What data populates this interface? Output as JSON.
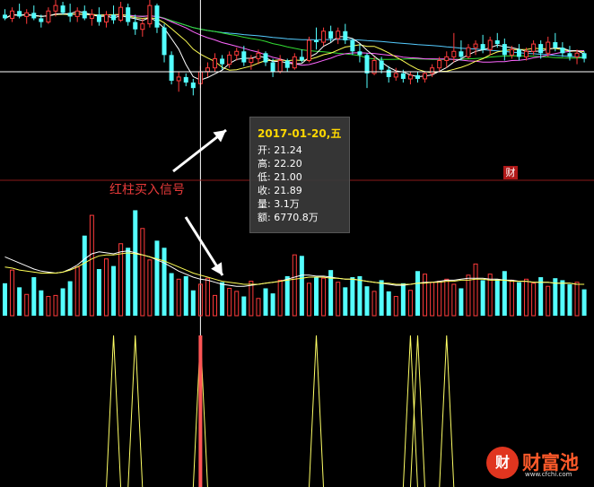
{
  "tooltip": {
    "date": "2017-01-20,五",
    "rows": [
      {
        "label": "开:",
        "value": "21.24"
      },
      {
        "label": "高:",
        "value": "22.20"
      },
      {
        "label": "低:",
        "value": "21.00"
      },
      {
        "label": "收:",
        "value": "21.89"
      },
      {
        "label": "量:",
        "value": "3.1万"
      },
      {
        "label": "额:",
        "value": "6770.8万"
      }
    ]
  },
  "annotation": "红柱买入信号",
  "badge": "财",
  "logo": {
    "icon": "财",
    "text": "财富池",
    "url": "www.cfchi.com"
  },
  "colors": {
    "up": "#ff3b3b",
    "down": "#54ffff",
    "ma5": "#ffffff",
    "ma10": "#ffff55",
    "ma20": "#ff66ff",
    "ma30": "#33dd33",
    "ma60": "#55ccff",
    "signal": "#ffff66",
    "signal_bar": "#ff5555",
    "crosshair": "#ffffff",
    "divider": "#8a1a1a"
  },
  "chart_data": [
    {
      "type": "candlestick",
      "name": "price",
      "ylim": [
        19.2,
        25.8
      ],
      "crosshair_index": 27,
      "crosshair_price": 21.89,
      "candles": [
        [
          25.0,
          25.3,
          24.7,
          24.8
        ],
        [
          24.8,
          25.4,
          24.6,
          25.2
        ],
        [
          25.2,
          25.6,
          24.8,
          24.9
        ],
        [
          24.9,
          25.3,
          24.5,
          25.1
        ],
        [
          25.1,
          25.5,
          24.7,
          24.8
        ],
        [
          24.8,
          25.0,
          24.3,
          24.6
        ],
        [
          24.6,
          25.4,
          24.5,
          25.2
        ],
        [
          25.2,
          25.8,
          24.9,
          25.5
        ],
        [
          25.5,
          25.7,
          25.0,
          25.1
        ],
        [
          25.1,
          25.6,
          24.6,
          24.9
        ],
        [
          24.9,
          25.4,
          24.6,
          25.2
        ],
        [
          25.2,
          25.5,
          24.7,
          24.8
        ],
        [
          24.8,
          25.3,
          24.4,
          25.0
        ],
        [
          25.0,
          25.4,
          24.4,
          24.6
        ],
        [
          24.6,
          25.2,
          24.3,
          25.0
        ],
        [
          25.0,
          25.5,
          24.5,
          24.7
        ],
        [
          24.7,
          25.7,
          24.6,
          25.4
        ],
        [
          25.4,
          25.6,
          24.4,
          24.6
        ],
        [
          24.6,
          25.0,
          23.9,
          24.2
        ],
        [
          24.2,
          24.8,
          23.8,
          24.5
        ],
        [
          24.5,
          25.8,
          24.3,
          25.5
        ],
        [
          25.5,
          25.6,
          24.0,
          24.3
        ],
        [
          24.3,
          24.5,
          22.4,
          22.8
        ],
        [
          22.8,
          23.0,
          21.2,
          21.4
        ],
        [
          21.4,
          21.9,
          20.8,
          21.6
        ],
        [
          21.6,
          21.8,
          21.1,
          21.3
        ],
        [
          21.3,
          21.5,
          20.6,
          21.0
        ],
        [
          21.24,
          22.2,
          21.0,
          21.89
        ],
        [
          21.9,
          22.4,
          21.6,
          22.1
        ],
        [
          22.1,
          22.9,
          21.9,
          22.6
        ],
        [
          22.6,
          22.8,
          22.0,
          22.3
        ],
        [
          22.3,
          23.0,
          22.1,
          22.8
        ],
        [
          22.8,
          23.2,
          22.5,
          23.0
        ],
        [
          23.0,
          23.3,
          22.2,
          22.4
        ],
        [
          22.4,
          22.8,
          22.0,
          22.6
        ],
        [
          22.6,
          23.1,
          22.3,
          22.9
        ],
        [
          22.9,
          23.0,
          22.2,
          22.4
        ],
        [
          22.4,
          22.6,
          21.6,
          21.9
        ],
        [
          21.9,
          22.8,
          21.8,
          22.5
        ],
        [
          22.5,
          22.6,
          21.9,
          22.1
        ],
        [
          22.1,
          22.9,
          22.0,
          22.7
        ],
        [
          22.7,
          23.1,
          22.4,
          22.5
        ],
        [
          22.5,
          23.8,
          22.4,
          23.6
        ],
        [
          23.6,
          24.3,
          23.1,
          23.5
        ],
        [
          23.5,
          24.3,
          23.3,
          24.1
        ],
        [
          24.1,
          24.4,
          23.5,
          23.7
        ],
        [
          23.7,
          24.3,
          23.4,
          24.1
        ],
        [
          24.1,
          24.5,
          23.4,
          23.6
        ],
        [
          23.6,
          23.7,
          22.8,
          23.0
        ],
        [
          23.0,
          23.4,
          22.4,
          22.8
        ],
        [
          22.8,
          22.9,
          21.0,
          21.8
        ],
        [
          21.8,
          22.7,
          21.7,
          22.5
        ],
        [
          22.5,
          22.7,
          21.8,
          22.0
        ],
        [
          22.0,
          22.2,
          21.3,
          21.6
        ],
        [
          21.6,
          22.1,
          21.4,
          21.8
        ],
        [
          21.8,
          22.0,
          21.3,
          21.5
        ],
        [
          21.5,
          21.9,
          21.2,
          21.7
        ],
        [
          21.7,
          21.9,
          21.3,
          21.5
        ],
        [
          21.5,
          21.9,
          21.3,
          21.8
        ],
        [
          21.8,
          22.3,
          21.6,
          22.1
        ],
        [
          22.1,
          22.7,
          21.9,
          22.5
        ],
        [
          22.5,
          23.0,
          22.1,
          22.7
        ],
        [
          22.7,
          24.0,
          22.4,
          23.0
        ],
        [
          23.0,
          23.6,
          22.5,
          22.7
        ],
        [
          22.7,
          23.4,
          22.6,
          23.2
        ],
        [
          23.2,
          23.6,
          22.8,
          23.4
        ],
        [
          23.4,
          23.9,
          22.9,
          23.1
        ],
        [
          23.1,
          23.8,
          22.8,
          23.6
        ],
        [
          23.6,
          24.0,
          23.2,
          23.4
        ],
        [
          23.4,
          23.7,
          22.5,
          22.8
        ],
        [
          22.8,
          23.3,
          22.6,
          23.1
        ],
        [
          23.1,
          23.4,
          22.5,
          22.7
        ],
        [
          22.7,
          23.2,
          22.5,
          23.0
        ],
        [
          23.0,
          23.6,
          22.8,
          23.4
        ],
        [
          23.4,
          23.6,
          22.6,
          22.9
        ],
        [
          22.9,
          23.8,
          22.7,
          23.5
        ],
        [
          23.5,
          24.0,
          23.0,
          23.2
        ],
        [
          23.2,
          23.5,
          22.7,
          22.9
        ],
        [
          22.9,
          23.3,
          22.5,
          22.7
        ],
        [
          22.7,
          23.1,
          22.3,
          22.9
        ],
        [
          22.9,
          23.0,
          22.4,
          22.6
        ]
      ]
    },
    {
      "type": "bar",
      "name": "volume",
      "ylim": [
        0,
        11.5
      ],
      "values": [
        3.2,
        4.5,
        2.8,
        2.1,
        3.8,
        2.5,
        1.9,
        2.0,
        2.7,
        3.4,
        4.8,
        7.9,
        9.9,
        4.6,
        5.6,
        4.9,
        7.1,
        6.7,
        10.4,
        8.6,
        5.5,
        7.4,
        6.7,
        4.2,
        3.6,
        3.9,
        2.5,
        3.1,
        3.7,
        2.0,
        3.3,
        2.7,
        2.4,
        1.9,
        3.4,
        1.7,
        2.7,
        2.2,
        3.5,
        3.9,
        6.0,
        5.9,
        3.2,
        3.8,
        3.7,
        4.5,
        3.3,
        2.8,
        3.8,
        3.9,
        2.9,
        2.4,
        3.5,
        2.4,
        1.9,
        3.2,
        2.5,
        4.4,
        4.1,
        3.3,
        3.4,
        3.6,
        3.1,
        2.7,
        4.0,
        5.1,
        3.5,
        4.1,
        3.6,
        4.4,
        3.5,
        3.3,
        3.6,
        3.2,
        3.8,
        2.9,
        3.7,
        3.5,
        3.1,
        3.3,
        2.6
      ],
      "ma1": [
        5.8,
        5.5,
        5.2,
        4.9,
        4.6,
        4.4,
        4.3,
        4.2,
        4.3,
        4.6,
        5.0,
        5.6,
        6.1,
        6.3,
        6.2,
        6.1,
        6.3,
        6.4,
        6.2,
        6.0,
        5.8,
        5.5,
        5.2,
        4.8,
        4.4,
        4.1,
        3.8,
        3.6,
        3.5,
        3.3,
        3.1,
        3.0,
        2.9,
        2.9,
        3.0,
        3.1,
        3.2,
        3.3,
        3.4,
        3.6,
        3.8,
        4.0,
        4.0,
        3.9,
        3.9,
        3.8,
        3.7,
        3.6,
        3.6,
        3.5,
        3.4,
        3.3,
        3.2,
        3.1,
        3.0,
        3.0,
        3.1,
        3.2,
        3.3,
        3.3,
        3.4,
        3.5,
        3.5,
        3.6,
        3.7,
        3.7,
        3.7,
        3.6,
        3.6,
        3.5,
        3.5,
        3.4,
        3.4,
        3.3,
        3.3,
        3.3,
        3.2,
        3.2,
        3.2,
        3.1,
        3.1
      ],
      "ma2": [
        4.8,
        4.7,
        4.5,
        4.4,
        4.3,
        4.2,
        4.2,
        4.2,
        4.3,
        4.5,
        4.8,
        5.2,
        5.6,
        5.9,
        6.0,
        6.0,
        6.1,
        6.2,
        6.1,
        6.0,
        5.8,
        5.6,
        5.4,
        5.1,
        4.8,
        4.5,
        4.2,
        4.0,
        3.8,
        3.6,
        3.4,
        3.3,
        3.2,
        3.1,
        3.1,
        3.1,
        3.2,
        3.3,
        3.4,
        3.5,
        3.6,
        3.7,
        3.8,
        3.8,
        3.8,
        3.7,
        3.7,
        3.6,
        3.6,
        3.5,
        3.4,
        3.3,
        3.2,
        3.2,
        3.1,
        3.1,
        3.1,
        3.2,
        3.2,
        3.3,
        3.3,
        3.4,
        3.4,
        3.5,
        3.5,
        3.6,
        3.6,
        3.5,
        3.5,
        3.5,
        3.4,
        3.4,
        3.4,
        3.3,
        3.3,
        3.3,
        3.2,
        3.2,
        3.2,
        3.1,
        3.1
      ]
    },
    {
      "type": "line",
      "name": "signal",
      "ylim": [
        0,
        1
      ],
      "peaks": [
        15,
        18,
        27,
        43,
        56,
        57,
        61
      ]
    }
  ]
}
